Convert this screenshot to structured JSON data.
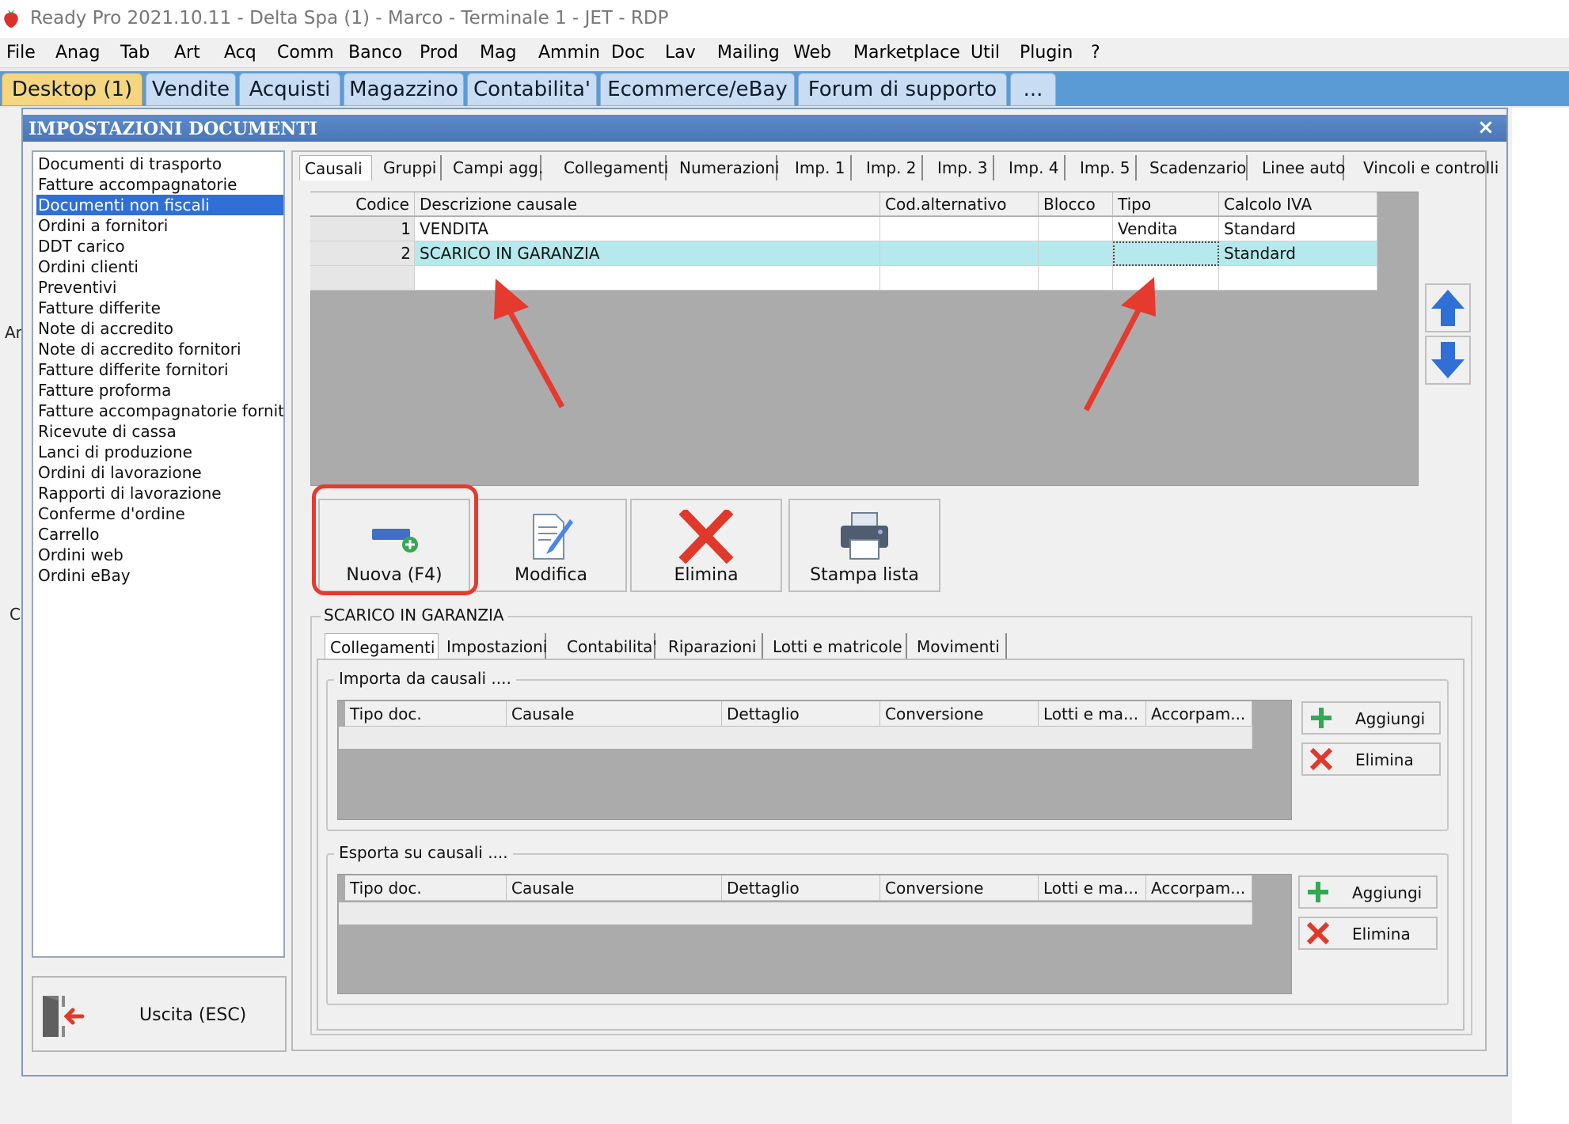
{
  "window": {
    "title": "Ready Pro 2021.10.11 - Delta Spa (1) - Marco - Terminale 1 - JET - RDP",
    "icon": "strawberry-icon"
  },
  "menu": [
    "File",
    "Anag",
    "Tab",
    "Art",
    "Acq",
    "Comm",
    "Banco",
    "Prod",
    "Mag",
    "Ammin",
    "Doc",
    "Lav",
    "Mailing",
    "Web",
    "Marketplace",
    "Util",
    "Plugin",
    "?"
  ],
  "main_tabs": [
    "Desktop (1)",
    "Vendite",
    "Acquisti",
    "Magazzino",
    "Contabilita'",
    "Ecommerce/eBay",
    "Forum di supporto",
    "..."
  ],
  "dialog": {
    "title": "IMPOSTAZIONI DOCUMENTI",
    "close": "×",
    "doc_types": [
      "Documenti di trasporto",
      "Fatture accompagnatorie",
      "Documenti non fiscali",
      "Ordini a fornitori",
      "DDT carico",
      "Ordini clienti",
      "Preventivi",
      "Fatture differite",
      "Note di accredito",
      "Note di accredito fornitori",
      "Fatture differite fornitori",
      "Fatture proforma",
      "Fatture accompagnatorie fornito",
      "Ricevute di cassa",
      "Lanci di produzione",
      "Ordini di lavorazione",
      "Rapporti di lavorazione",
      "Conferme d'ordine",
      "Carrello",
      "Ordini web",
      "Ordini eBay"
    ],
    "selected_doc_type": "Documenti non fiscali",
    "exit_button": "Uscita (ESC)",
    "sub_tabs": [
      "Causali",
      "Gruppi",
      "Campi agg.",
      "Collegamenti",
      "Numerazioni",
      "Imp. 1",
      "Imp. 2",
      "Imp. 3",
      "Imp. 4",
      "Imp. 5",
      "Scadenzario",
      "Linee auto",
      "Vincoli e controlli"
    ],
    "causali_grid": {
      "columns": [
        "Codice",
        "Descrizione causale",
        "Cod.alternativo",
        "Blocco",
        "Tipo",
        "Calcolo IVA"
      ],
      "rows": [
        {
          "codice": "1",
          "descrizione": "VENDITA",
          "cod_alt": "",
          "blocco": "",
          "tipo": "Vendita",
          "calcolo_iva": "Standard"
        },
        {
          "codice": "2",
          "descrizione": "SCARICO IN GARANZIA",
          "cod_alt": "",
          "blocco": "",
          "tipo": "",
          "calcolo_iva": "Standard"
        }
      ]
    },
    "actions": {
      "new": "Nuova (F4)",
      "edit": "Modifica",
      "delete": "Elimina",
      "print": "Stampa lista"
    },
    "detail": {
      "caption": "SCARICO IN GARANZIA",
      "tabs": [
        "Collegamenti",
        "Impostazioni",
        "Contabilita'",
        "Riparazioni",
        "Lotti e matricole",
        "Movimenti"
      ],
      "import_group": "Importa da causali ....",
      "export_group": "Esporta su causali ....",
      "link_columns": [
        "Tipo doc.",
        "Causale",
        "Dettaglio",
        "Conversione",
        "Lotti e ma...",
        "Accorpam..."
      ],
      "add_button": "Aggiungi",
      "delete_button": "Elimina"
    }
  },
  "left_fragments": {
    "ar": "Ar",
    "c": "C"
  },
  "colors": {
    "accent_tab": "#f5d580",
    "tab_band": "#5b9bd5",
    "selection": "#2f6fd6",
    "row_highlight": "#b5e9ed",
    "annotation": "#e53a2e"
  }
}
